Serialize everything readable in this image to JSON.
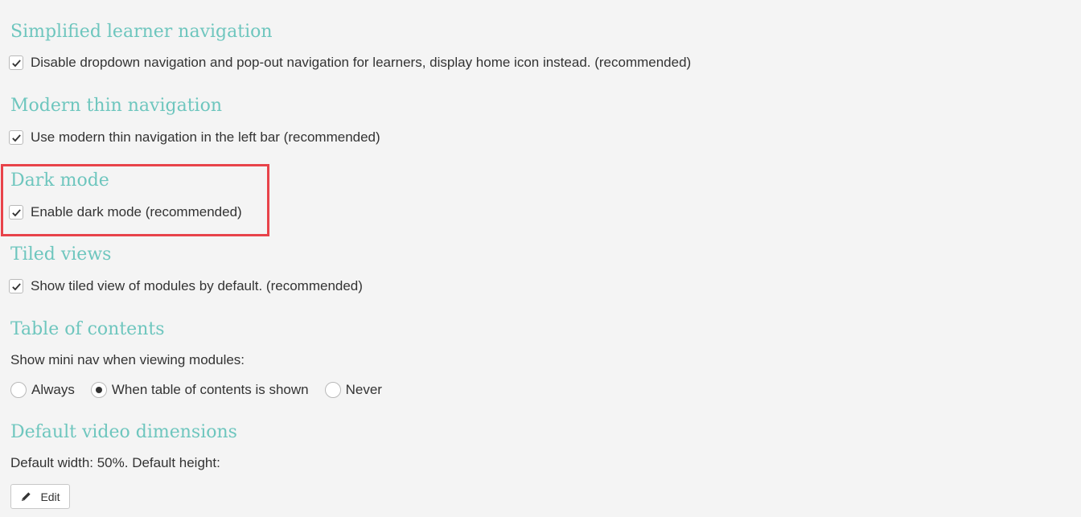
{
  "sections": {
    "simplified": {
      "title": "Simplified learner navigation",
      "checkbox_label": "Disable dropdown navigation and pop-out navigation for learners, display home icon instead. (recommended)",
      "checked": true
    },
    "modern_thin": {
      "title": "Modern thin navigation",
      "checkbox_label": "Use modern thin navigation in the left bar (recommended)",
      "checked": true
    },
    "dark_mode": {
      "title": "Dark mode",
      "checkbox_label": "Enable dark mode (recommended)",
      "checked": true
    },
    "tiled_views": {
      "title": "Tiled views",
      "checkbox_label": "Show tiled view of modules by default. (recommended)",
      "checked": true
    },
    "toc": {
      "title": "Table of contents",
      "description": "Show mini nav when viewing modules:",
      "options": [
        {
          "label": "Always",
          "selected": false
        },
        {
          "label": "When table of contents is shown",
          "selected": true
        },
        {
          "label": "Never",
          "selected": false
        }
      ]
    },
    "video": {
      "title": "Default video dimensions",
      "description": "Default width: 50%. Default height:",
      "edit_label": "Edit",
      "edit_icon": "pencil-icon"
    }
  },
  "colors": {
    "heading": "#6ec6be",
    "highlight": "#e8434a",
    "background": "#f4f4f4",
    "text": "#333333"
  }
}
